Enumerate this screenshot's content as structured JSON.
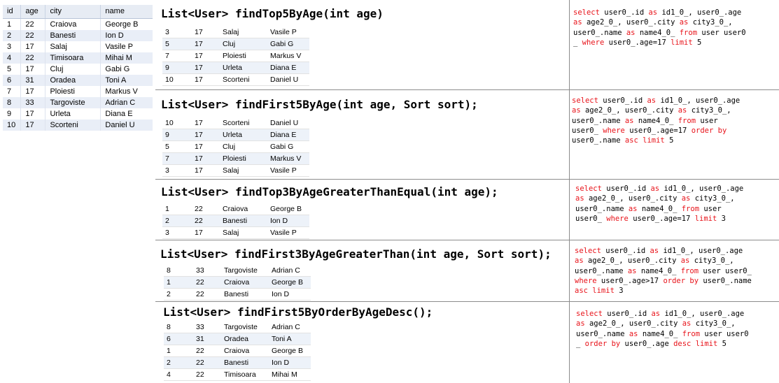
{
  "left_table": {
    "headers": [
      "id",
      "age",
      "city",
      "name"
    ],
    "rows": [
      [
        "1",
        "22",
        "Craiova",
        "George B"
      ],
      [
        "2",
        "22",
        "Banesti",
        "Ion D"
      ],
      [
        "3",
        "17",
        "Salaj",
        "Vasile P"
      ],
      [
        "4",
        "22",
        "Timisoara",
        "Mihai M"
      ],
      [
        "5",
        "17",
        "Cluj",
        "Gabi G"
      ],
      [
        "6",
        "31",
        "Oradea",
        "Toni A"
      ],
      [
        "7",
        "17",
        "Ploiesti",
        "Markus V"
      ],
      [
        "8",
        "33",
        "Targoviste",
        "Adrian C"
      ],
      [
        "9",
        "17",
        "Urleta",
        "Diana E"
      ],
      [
        "10",
        "17",
        "Scorteni",
        "Daniel U"
      ]
    ]
  },
  "panels": [
    {
      "method": "List<User> findTop5ByAge(int age)",
      "rows": [
        [
          "3",
          "17",
          "Salaj",
          "Vasile P"
        ],
        [
          "5",
          "17",
          "Cluj",
          "Gabi G"
        ],
        [
          "7",
          "17",
          "Ploiesti",
          "Markus V"
        ],
        [
          "9",
          "17",
          "Urleta",
          "Diana E"
        ],
        [
          "10",
          "17",
          "Scorteni",
          "Daniel U"
        ]
      ],
      "sql_lines": [
        [
          [
            "kw",
            "select"
          ],
          [
            "t",
            " user0_.id "
          ],
          [
            "kw",
            "as"
          ],
          [
            "t",
            " id1_0_, user0_.age"
          ]
        ],
        [
          [
            "kw",
            "as"
          ],
          [
            "t",
            " age2_0_, user0_.city "
          ],
          [
            "kw",
            "as"
          ],
          [
            "t",
            " city3_0_,"
          ]
        ],
        [
          [
            "t",
            "user0_.name "
          ],
          [
            "kw",
            "as"
          ],
          [
            "t",
            " name4_0_ "
          ],
          [
            "kw",
            "from"
          ],
          [
            "t",
            " user user0"
          ]
        ],
        [
          [
            "t",
            "_ "
          ],
          [
            "kw",
            "where"
          ],
          [
            "t",
            " user0_.age=17 "
          ],
          [
            "kw",
            "limit"
          ],
          [
            "t",
            " 5"
          ]
        ]
      ]
    },
    {
      "method": "List<User> findFirst5ByAge(int age, Sort sort);",
      "rows": [
        [
          "10",
          "17",
          "Scorteni",
          "Daniel U"
        ],
        [
          "9",
          "17",
          "Urleta",
          "Diana E"
        ],
        [
          "5",
          "17",
          "Cluj",
          "Gabi G"
        ],
        [
          "7",
          "17",
          "Ploiesti",
          "Markus V"
        ],
        [
          "3",
          "17",
          "Salaj",
          "Vasile P"
        ]
      ],
      "sql_lines": [
        [
          [
            "kw",
            "select"
          ],
          [
            "t",
            " user0_.id "
          ],
          [
            "kw",
            "as"
          ],
          [
            "t",
            " id1_0_, user0_.age"
          ]
        ],
        [
          [
            "kw",
            "as"
          ],
          [
            "t",
            " age2_0_, user0_.city "
          ],
          [
            "kw",
            "as"
          ],
          [
            "t",
            " city3_0_,"
          ]
        ],
        [
          [
            "t",
            "user0_.name "
          ],
          [
            "kw",
            "as"
          ],
          [
            "t",
            " name4_0_ "
          ],
          [
            "kw",
            "from"
          ],
          [
            "t",
            " user"
          ]
        ],
        [
          [
            "t",
            "user0_ "
          ],
          [
            "kw",
            "where"
          ],
          [
            "t",
            " user0_.age=17 "
          ],
          [
            "kw",
            "order by"
          ]
        ],
        [
          [
            "t",
            "user0_.name "
          ],
          [
            "kw",
            "asc limit"
          ],
          [
            "t",
            " 5"
          ]
        ]
      ]
    },
    {
      "method": "List<User> findTop3ByAgeGreaterThanEqual(int age);",
      "rows": [
        [
          "1",
          "22",
          "Craiova",
          "George B"
        ],
        [
          "2",
          "22",
          "Banesti",
          "Ion D"
        ],
        [
          "3",
          "17",
          "Salaj",
          "Vasile P"
        ]
      ],
      "sql_lines": [
        [
          [
            "kw",
            "select"
          ],
          [
            "t",
            " user0_.id "
          ],
          [
            "kw",
            "as"
          ],
          [
            "t",
            " id1_0_, user0_.age"
          ]
        ],
        [
          [
            "kw",
            "as"
          ],
          [
            "t",
            " age2_0_, user0_.city "
          ],
          [
            "kw",
            "as"
          ],
          [
            "t",
            " city3_0_,"
          ]
        ],
        [
          [
            "t",
            "user0_.name "
          ],
          [
            "kw",
            "as"
          ],
          [
            "t",
            " name4_0_ "
          ],
          [
            "kw",
            "from"
          ],
          [
            "t",
            " user"
          ]
        ],
        [
          [
            "t",
            "user0_ "
          ],
          [
            "kw",
            "where"
          ],
          [
            "t",
            " user0_.age=17 "
          ],
          [
            "kw",
            "limit"
          ],
          [
            "t",
            " 3"
          ]
        ]
      ]
    },
    {
      "method": "List<User> findFirst3ByAgeGreaterThan(int age, Sort sort);",
      "rows": [
        [
          "8",
          "33",
          "Targoviste",
          "Adrian C"
        ],
        [
          "1",
          "22",
          "Craiova",
          "George B"
        ],
        [
          "2",
          "22",
          "Banesti",
          "Ion D"
        ]
      ],
      "sql_lines": [
        [
          [
            "kw",
            "select"
          ],
          [
            "t",
            " user0_.id "
          ],
          [
            "kw",
            "as"
          ],
          [
            "t",
            " id1_0_, user0_.age"
          ]
        ],
        [
          [
            "kw",
            "as"
          ],
          [
            "t",
            " age2_0_, user0_.city "
          ],
          [
            "kw",
            "as"
          ],
          [
            "t",
            " city3_0_,"
          ]
        ],
        [
          [
            "t",
            "user0_.name "
          ],
          [
            "kw",
            "as"
          ],
          [
            "t",
            " name4_0_ "
          ],
          [
            "kw",
            "from"
          ],
          [
            "t",
            " user user0_"
          ]
        ],
        [
          [
            "kw",
            "where"
          ],
          [
            "t",
            " user0_.age>17 "
          ],
          [
            "kw",
            "order by"
          ],
          [
            "t",
            " user0_.name"
          ]
        ],
        [
          [
            "kw",
            "asc limit"
          ],
          [
            "t",
            " 3"
          ]
        ]
      ]
    },
    {
      "method": "List<User> findFirst5ByOrderByAgeDesc();",
      "rows": [
        [
          "8",
          "33",
          "Targoviste",
          "Adrian C"
        ],
        [
          "6",
          "31",
          "Oradea",
          "Toni A"
        ],
        [
          "1",
          "22",
          "Craiova",
          "George B"
        ],
        [
          "2",
          "22",
          "Banesti",
          "Ion D"
        ],
        [
          "4",
          "22",
          "Timisoara",
          "Mihai M"
        ]
      ],
      "sql_lines": [
        [
          [
            "kw",
            "select"
          ],
          [
            "t",
            " user0_.id "
          ],
          [
            "kw",
            "as"
          ],
          [
            "t",
            " id1_0_, user0_.age"
          ]
        ],
        [
          [
            "kw",
            "as"
          ],
          [
            "t",
            " age2_0_, user0_.city "
          ],
          [
            "kw",
            "as"
          ],
          [
            "t",
            " city3_0_,"
          ]
        ],
        [
          [
            "t",
            "user0_.name "
          ],
          [
            "kw",
            "as"
          ],
          [
            "t",
            " name4_0_ "
          ],
          [
            "kw",
            "from"
          ],
          [
            "t",
            " user user0"
          ]
        ],
        [
          [
            "t",
            "_ "
          ],
          [
            "kw",
            "order by"
          ],
          [
            "t",
            " user0_.age "
          ],
          [
            "kw",
            "desc limit"
          ],
          [
            "t",
            " 5"
          ]
        ]
      ]
    }
  ]
}
